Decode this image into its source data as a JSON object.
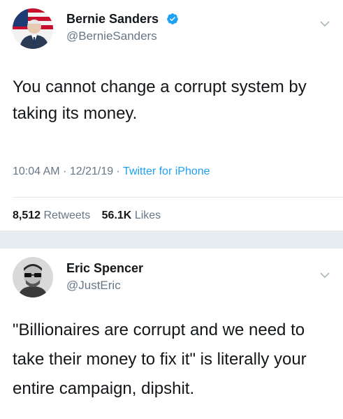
{
  "tweets": [
    {
      "author": {
        "name": "Bernie Sanders",
        "handle": "@BernieSanders",
        "verified": true
      },
      "text": "You cannot change a corrupt system by taking its money.",
      "meta": {
        "time": "10:04 AM",
        "sep1": " · ",
        "date": "12/21/19",
        "sep2": " · ",
        "source": "Twitter for iPhone"
      },
      "stats": {
        "retweets": "8,512",
        "retweets_label": "Retweets",
        "likes": "56.1K",
        "likes_label": "Likes"
      },
      "menu_icon": "chevron-down-icon"
    },
    {
      "author": {
        "name": "Eric Spencer",
        "handle": "@JustEric"
      },
      "text": "\"Billionaires are corrupt and we need to take their money to fix it\" is literally your entire campaign, dipshit.",
      "menu_icon": "chevron-down-icon"
    }
  ],
  "colors": {
    "text": "#14171a",
    "secondary": "#657786",
    "link": "#1da1f2",
    "separator": "#e6ecf0"
  }
}
